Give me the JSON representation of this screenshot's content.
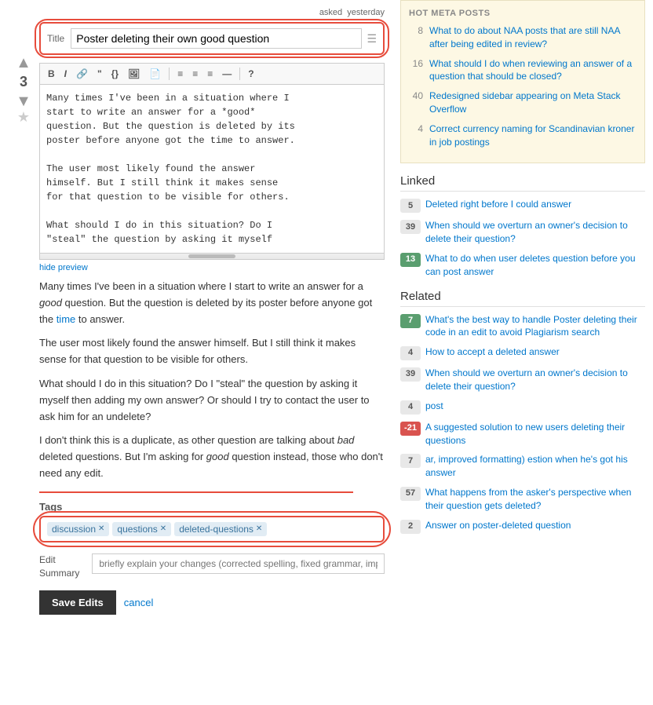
{
  "page": {
    "asked_label": "asked",
    "asked_time": "yesterday"
  },
  "title_section": {
    "label": "Title",
    "value": "Poster deleting their own good question",
    "icon": "☰"
  },
  "toolbar": {
    "buttons": [
      "B",
      "I",
      "🔗",
      "\"",
      "{}",
      "🖼",
      "📄",
      "≡",
      "≡",
      "≡",
      "—",
      "🔍"
    ]
  },
  "editor": {
    "content_lines": [
      "Many times I've been in a situation where I",
      "start to write an answer for a *good*",
      "question. But the question is deleted by its",
      "poster before anyone got the time to answer.",
      "",
      "The user most likely found the answer",
      "himself. But I still think it makes sense",
      "for that question to be visible for others.",
      "",
      "What should I do in this situation? Do I",
      "\"steal\" the question by asking it myself"
    ]
  },
  "hide_preview_label": "hide preview",
  "preview": {
    "paragraphs": [
      "Many times I've been in a situation where I start to write an answer for a good question. But the question is deleted by its poster before anyone got the time to answer.",
      "The user most likely found the answer himself. But I still think it makes sense for that question to be visible for others.",
      "What should I do in this situation? Do I \"steal\" the question by asking it myself then adding my own answer? Or should I try to contact the user to ask him for an undelete?",
      "I don't think this is a duplicate, as other question are talking about bad deleted questions. But I'm asking for good question instead, those who don't need any edit."
    ]
  },
  "tags": {
    "label": "Tags",
    "items": [
      {
        "text": "discussion",
        "removable": true
      },
      {
        "text": "questions",
        "removable": true
      },
      {
        "text": "deleted-questions",
        "removable": true
      }
    ]
  },
  "edit_summary": {
    "label_line1": "Edit",
    "label_line2": "Summary",
    "placeholder": "briefly explain your changes (corrected spelling, fixed grammar, improved formatting)"
  },
  "actions": {
    "save_label": "Save Edits",
    "cancel_label": "cancel"
  },
  "hot_meta": {
    "title": "HOT META POSTS",
    "items": [
      {
        "num": "8",
        "text": "What to do about NAA posts that are still NAA after being edited in review?"
      },
      {
        "num": "16",
        "text": "What should I do when reviewing an answer of a question that should be closed?"
      },
      {
        "num": "40",
        "text": "Redesigned sidebar appearing on Meta Stack Overflow"
      },
      {
        "num": "4",
        "text": "Correct currency naming for Scandinavian kroner in job postings"
      }
    ]
  },
  "linked": {
    "title": "Linked",
    "items": [
      {
        "badge": "5",
        "badge_type": "neutral",
        "text": "Deleted right before I could answer"
      },
      {
        "badge": "39",
        "badge_type": "neutral",
        "text": "When should we overturn an owner's decision to delete their question?"
      },
      {
        "badge": "13",
        "badge_type": "green",
        "text": "What to do when user deletes question before you can post answer"
      }
    ]
  },
  "related": {
    "title": "Related",
    "items": [
      {
        "badge": "7",
        "badge_type": "green",
        "text": "What's the best way to handle Poster deleting their code in an edit to avoid Plagiarism search"
      },
      {
        "badge": "4",
        "badge_type": "neutral",
        "text": "How to accept a deleted answer"
      },
      {
        "badge": "39",
        "badge_type": "neutral",
        "text": "When should we overturn an owner's decision to delete their question?"
      },
      {
        "badge": "4",
        "badge_type": "neutral",
        "text": "post"
      },
      {
        "badge": "-21",
        "badge_type": "red",
        "text": "A suggested solution to new users deleting their questions"
      },
      {
        "badge": "7",
        "badge_type": "neutral",
        "text": "ar, improved formatting) estion when he's got his answer"
      },
      {
        "badge": "57",
        "badge_type": "neutral",
        "text": "What happens from the asker's perspective when their question gets deleted?"
      },
      {
        "badge": "2",
        "badge_type": "neutral",
        "text": "Answer on poster-deleted question"
      }
    ]
  }
}
